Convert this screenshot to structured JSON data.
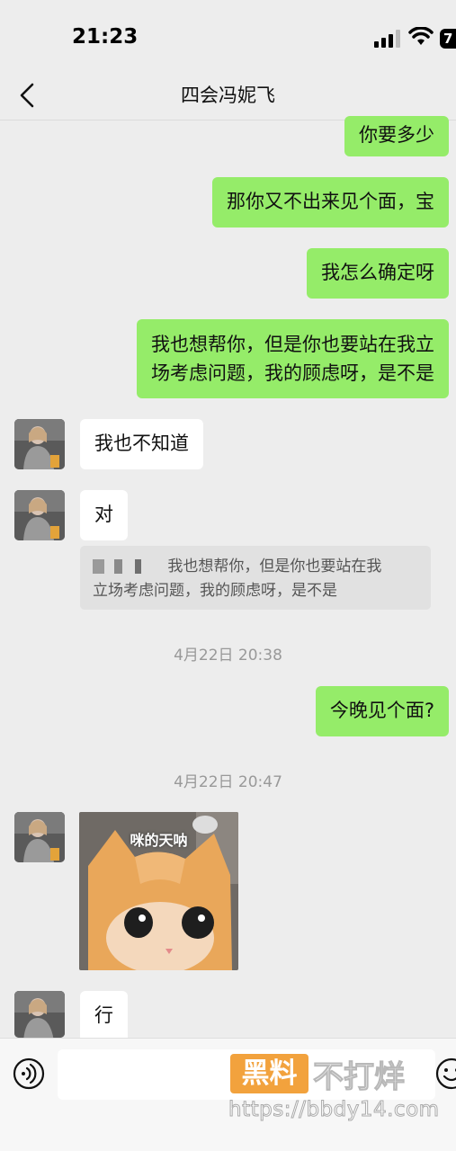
{
  "status_bar": {
    "time": "21:23",
    "battery": "7"
  },
  "header": {
    "title": "四会冯妮飞"
  },
  "messages": {
    "m1": "你要多少",
    "m2": "那你又不出来见个面，宝",
    "m3": "我怎么确定呀",
    "m4_line1": "我也想帮你，但是你也要站在我立",
    "m4_line2": "场考虑问题，我的顾虑呀，是不是",
    "m5": "我也不知道",
    "m6": "对",
    "quote_line1": "我也想帮你，但是你也要站在我",
    "quote_line2": "立场考虑问题，我的顾虑呀，是不是",
    "ts1": "4月22日 20:38",
    "m7": "今晚见个面?",
    "ts2": "4月22日 20:47",
    "sticker_caption": "咪的天呐",
    "m8": "行"
  },
  "watermark": {
    "badge": "黑料",
    "text": "不打烊",
    "url": "https://bbdy14.com"
  },
  "colors": {
    "background": "#ededed",
    "my_bubble": "#95ec69",
    "their_bubble": "#ffffff"
  },
  "icons": [
    "back-arrow-icon",
    "signal-icon",
    "wifi-icon",
    "battery-icon",
    "voice-icon",
    "emoji-icon"
  ]
}
